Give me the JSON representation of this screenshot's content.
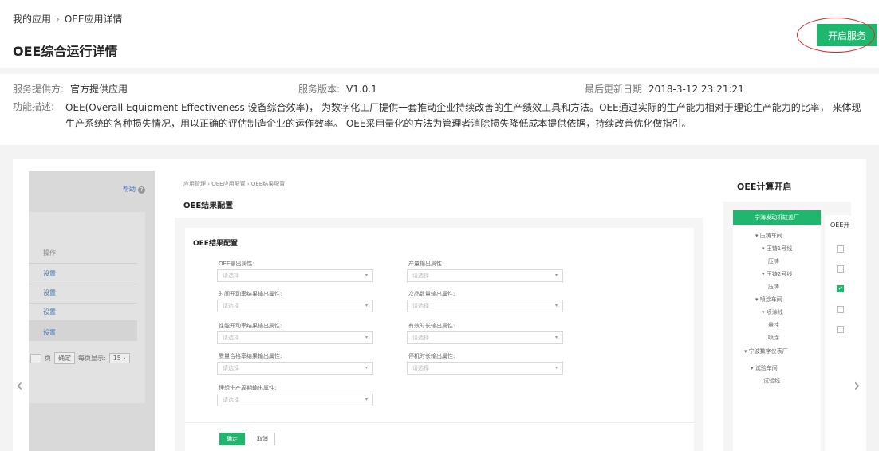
{
  "header": {
    "breadcrumb": [
      "我的应用",
      "OEE应用详情"
    ],
    "breadcrumb_sep": "›",
    "title": "OEE综合运行详情",
    "start_button": "开启服务"
  },
  "info": {
    "provider_label": "服务提供方:",
    "provider_value": "官方提供应用",
    "version_label": "服务版本:",
    "version_value": "V1.0.1",
    "updated_label": "最后更新日期",
    "updated_value": "2018-3-12 23:21:21",
    "desc_label": "功能描述:",
    "desc_text": "OEE(Overall Equipment Effectiveness 设备综合效率)， 为数字化工厂提供一套推动企业持续改善的生产绩效工具和方法。OEE通过实际的生产能力相对于理论生产能力的比率， 来体现生产系统的各种损失情况，用以正确的评估制造企业的运作效率。 OEE采用量化的方法为管理者消除损失降低成本提供依据，持续改善优化做指引。"
  },
  "carousel": {
    "prev": "‹",
    "next": "›",
    "left_shot": {
      "help": "帮助",
      "help_icon": "?",
      "col_header": "操作",
      "rows": [
        "设置",
        "设置",
        "设置",
        "设置"
      ],
      "pager_page": "页",
      "pager_confirm": "确定",
      "pager_show": "每页显示:",
      "pager_size": "15 ›"
    },
    "mid_shot": {
      "breadcrumb": "应用管理 › OEE应用配置 › OEE结果配置",
      "title": "OEE结果配置",
      "card_title": "OEE结果配置",
      "placeholder": "请选择",
      "caret": "▾",
      "fields_left": [
        "OEE输出属性:",
        "时间开动率结果输出属性:",
        "性能开动率结果输出属性:",
        "质量合格率结果输出属性:",
        "理想生产周期输出属性:"
      ],
      "fields_right": [
        "产量输出属性:",
        "次品数量输出属性:",
        "有效时长输出属性:",
        "停机时长输出属性:"
      ],
      "ok": "确定",
      "cancel": "取消"
    },
    "right_shot": {
      "title": "OEE计算开启",
      "tree_root": "宁海发动机缸盖厂",
      "tree": [
        "▾ 压铸车间",
        "▾ 压铸1号线",
        "压铸",
        "▾ 压铸2号线",
        "压铸",
        "▾ 喷涂车间",
        "▾ 喷涂线",
        "悬挂",
        "喷涂",
        "▾ 宁波数字仪表厂",
        "▾ 试验车间",
        "试验线"
      ],
      "col_header": "OEE开",
      "check_mark": "✓"
    }
  }
}
